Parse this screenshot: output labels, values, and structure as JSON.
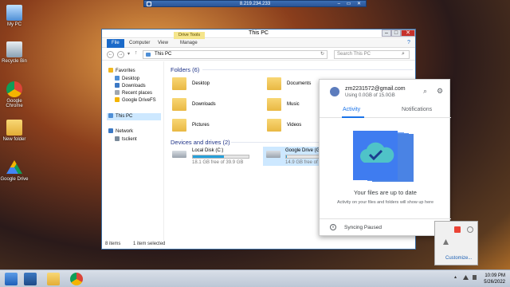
{
  "remote": {
    "title": "8.219.234.233"
  },
  "desktop": {
    "icons": [
      {
        "label": "My PC"
      },
      {
        "label": "Recycle Bin"
      },
      {
        "label": "Google Chrome"
      },
      {
        "label": "New folder"
      },
      {
        "label": "Google Drive"
      }
    ]
  },
  "explorer": {
    "title": "This PC",
    "context_tab": "Drive Tools",
    "tabs": [
      "File",
      "Computer",
      "View",
      "Manage"
    ],
    "address": "This PC",
    "search_placeholder": "Search This PC",
    "nav": {
      "favorites": "Favorites",
      "favorites_items": [
        "Desktop",
        "Downloads",
        "Recent places",
        "Google DriveFS"
      ],
      "this_pc": "This PC",
      "network": "Network",
      "network_items": [
        "tsclient"
      ]
    },
    "folders_header": "Folders (6)",
    "folders": [
      "Desktop",
      "Documents",
      "Downloads",
      "Music",
      "Pictures",
      "Videos"
    ],
    "drives_header": "Devices and drives (2)",
    "drives": [
      {
        "name": "Local Disk (C:)",
        "free": "18.1 GB free of 39.9 GB",
        "used_fraction": 0.55
      },
      {
        "name": "Google Drive (G:)",
        "free": "14.9 GB free of 15.0",
        "used_fraction": 0.01
      }
    ],
    "status": {
      "items": "8 items",
      "selected": "1 item selected"
    }
  },
  "drive_popup": {
    "email": "zm2231572@gmail.com",
    "quota": "Using 0.0GB of 15.0GB",
    "tabs": {
      "activity": "Activity",
      "notifications": "Notifications"
    },
    "headline": "Your files are up to date",
    "subtext": "Activity on your files and folders will show up here",
    "sync_status": "Syncing Paused",
    "colors": {
      "accent": "#1a73e8"
    }
  },
  "tray": {
    "customize": "Customize..."
  },
  "taskbar": {
    "time": "10:09 PM",
    "date": "5/26/2022"
  }
}
